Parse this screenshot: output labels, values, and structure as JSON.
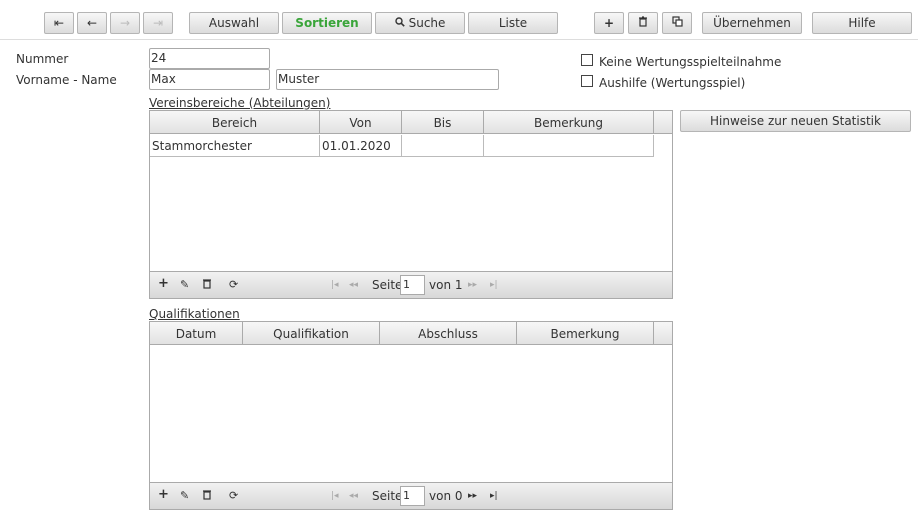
{
  "toolbar": {
    "first_icon": "⇤",
    "prev_icon": "←",
    "next_icon": "→",
    "last_icon": "⇥",
    "auswahl": "Auswahl",
    "sortieren": "Sortieren",
    "suche": "Suche",
    "liste": "Liste",
    "add_icon": "+",
    "delete_icon": "🗑",
    "copy_icon": "⧉",
    "uebernehmen": "Übernehmen",
    "hilfe": "Hilfe",
    "search_icon_glyph": "🔍",
    "accent_color": "#3aa53a"
  },
  "form": {
    "nummer_label": "Nummer",
    "nummer_value": "24",
    "vorname_name_label": "Vorname - Name",
    "vorname_value": "Max",
    "name_value": "Muster",
    "keine_label": "Keine Wertungsspielteilnahme",
    "aushilfe_label": "Aushilfe (Wertungsspiel)",
    "keine_checked": false,
    "aushilfe_checked": false
  },
  "vereinsbereiche": {
    "title": "Vereinsbereiche (Abteilungen)",
    "columns": [
      "Bereich",
      "Von",
      "Bis",
      "Bemerkung"
    ],
    "rows": [
      [
        "Stammorchester",
        "01.01.2020",
        "",
        ""
      ]
    ],
    "pager": {
      "seite_label": "Seite",
      "page": "1",
      "von_label": "von 1"
    }
  },
  "qualifikationen": {
    "title": "Qualifikationen",
    "columns": [
      "Datum",
      "Qualifikation",
      "Abschluss",
      "Bemerkung"
    ],
    "rows": [],
    "pager": {
      "seite_label": "Seite",
      "page": "1",
      "von_label": "von 0"
    }
  },
  "hinweise_button": "Hinweise zur neuen Statistik"
}
